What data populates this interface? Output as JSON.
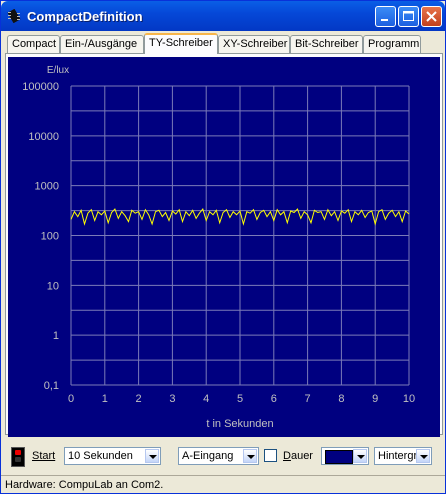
{
  "window": {
    "title": "CompactDefinition"
  },
  "tabs": [
    {
      "label": "Compact"
    },
    {
      "label": "Ein-/Ausgänge"
    },
    {
      "label": "TY-Schreiber"
    },
    {
      "label": "XY-Schreiber"
    },
    {
      "label": "Bit-Schreiber"
    },
    {
      "label": "Programm"
    }
  ],
  "active_tab": 2,
  "chart_data": {
    "type": "line",
    "ylabel": "E/lux",
    "xlabel": "t in Sekunden",
    "y_scale": "log",
    "ylim": [
      0.1,
      100000
    ],
    "xlim": [
      0,
      10
    ],
    "x_ticks": [
      "0",
      "1",
      "2",
      "3",
      "4",
      "5",
      "6",
      "7",
      "8",
      "9",
      "10"
    ],
    "y_ticks": [
      "100000",
      "10000",
      "1000",
      "100",
      "10",
      "1",
      "0,1"
    ],
    "grid": true,
    "background_color": "#000080",
    "line_color": "#FFFF00",
    "series": [
      {
        "x": [
          0,
          0.1,
          0.2,
          0.3,
          0.4,
          0.5,
          0.6,
          0.7,
          0.8,
          0.9,
          1.0,
          1.1,
          1.2,
          1.3,
          1.4,
          1.5,
          1.6,
          1.7,
          1.8,
          1.9,
          2.0,
          2.1,
          2.2,
          2.3,
          2.4,
          2.5,
          2.6,
          2.7,
          2.8,
          2.9,
          3.0,
          3.1,
          3.2,
          3.3,
          3.4,
          3.5,
          3.6,
          3.7,
          3.8,
          3.9,
          4.0,
          4.1,
          4.2,
          4.3,
          4.4,
          4.5,
          4.6,
          4.7,
          4.8,
          4.9,
          5.0,
          5.1,
          5.2,
          5.3,
          5.4,
          5.5,
          5.6,
          5.7,
          5.8,
          5.9,
          6.0,
          6.1,
          6.2,
          6.3,
          6.4,
          6.5,
          6.6,
          6.7,
          6.8,
          6.9,
          7.0,
          7.1,
          7.2,
          7.3,
          7.4,
          7.5,
          7.6,
          7.7,
          7.8,
          7.9,
          8.0,
          8.1,
          8.2,
          8.3,
          8.4,
          8.5,
          8.6,
          8.7,
          8.8,
          8.9,
          9.0,
          9.1,
          9.2,
          9.3,
          9.4,
          9.5,
          9.6,
          9.7,
          9.8,
          9.9,
          10.0
        ],
        "values": [
          210,
          300,
          240,
          320,
          170,
          280,
          330,
          200,
          300,
          260,
          310,
          180,
          290,
          340,
          220,
          300,
          250,
          190,
          320,
          280,
          300,
          210,
          330,
          260,
          170,
          300,
          320,
          240,
          290,
          200,
          310,
          270,
          330,
          190,
          300,
          250,
          320,
          220,
          280,
          340,
          200,
          300,
          260,
          320,
          180,
          290,
          330,
          230,
          300,
          260,
          310,
          170,
          300,
          280,
          330,
          210,
          290,
          320,
          240,
          300,
          200,
          330,
          260,
          300,
          180,
          310,
          290,
          340,
          220,
          300,
          260,
          180,
          320,
          290,
          300,
          210,
          330,
          250,
          300,
          200,
          310,
          280,
          330,
          190,
          300,
          260,
          320,
          230,
          290,
          310,
          170,
          300,
          330,
          210,
          280,
          320,
          240,
          300,
          190,
          310,
          270
        ]
      }
    ]
  },
  "controls": {
    "start_label": "Start",
    "time_select": "10 Sekunden",
    "input_select": "A-Eingang",
    "dauer_label": "Dauer",
    "color_value": "#000080",
    "background_select": "Hintergr"
  },
  "status": {
    "text": "Hardware: CompuLab an Com2."
  }
}
